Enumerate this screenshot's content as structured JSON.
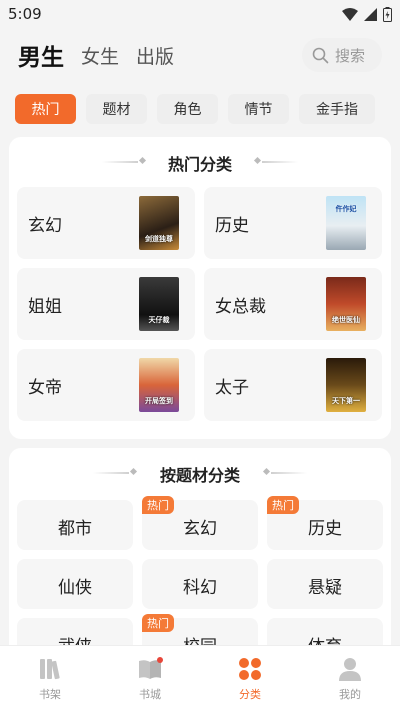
{
  "status_bar": {
    "time": "5:09"
  },
  "header": {
    "tabs": [
      {
        "label": "男生",
        "active": true
      },
      {
        "label": "女生",
        "active": false
      },
      {
        "label": "出版",
        "active": false
      }
    ],
    "search_placeholder": "搜索"
  },
  "chips": [
    {
      "label": "热门",
      "active": true
    },
    {
      "label": "题材",
      "active": false
    },
    {
      "label": "角色",
      "active": false
    },
    {
      "label": "情节",
      "active": false
    },
    {
      "label": "金手指",
      "active": false
    }
  ],
  "hot_section": {
    "title": "热门分类",
    "items": [
      {
        "label": "玄幻",
        "cover_text": "剑道独尊"
      },
      {
        "label": "历史",
        "cover_text": "仵作妃"
      },
      {
        "label": "姐姐",
        "cover_text": "天仔裁"
      },
      {
        "label": "女总裁",
        "cover_text": "绝世医仙"
      },
      {
        "label": "女帝",
        "cover_text": "开局签到"
      },
      {
        "label": "太子",
        "cover_text": "天下第一"
      }
    ]
  },
  "topic_section": {
    "title": "按题材分类",
    "badge_label": "热门",
    "items": [
      {
        "label": "都市",
        "hot": false
      },
      {
        "label": "玄幻",
        "hot": true
      },
      {
        "label": "历史",
        "hot": true
      },
      {
        "label": "仙侠",
        "hot": false
      },
      {
        "label": "科幻",
        "hot": false
      },
      {
        "label": "悬疑",
        "hot": false
      },
      {
        "label": "武侠",
        "hot": false
      },
      {
        "label": "校园",
        "hot": true
      },
      {
        "label": "体育",
        "hot": false
      }
    ]
  },
  "bottom_nav": [
    {
      "label": "书架",
      "icon": "bookshelf-icon",
      "active": false
    },
    {
      "label": "书城",
      "icon": "bookstore-icon",
      "active": false
    },
    {
      "label": "分类",
      "icon": "category-icon",
      "active": true
    },
    {
      "label": "我的",
      "icon": "profile-icon",
      "active": false
    }
  ],
  "colors": {
    "accent": "#f26a2b",
    "badge": "#f47a37"
  }
}
